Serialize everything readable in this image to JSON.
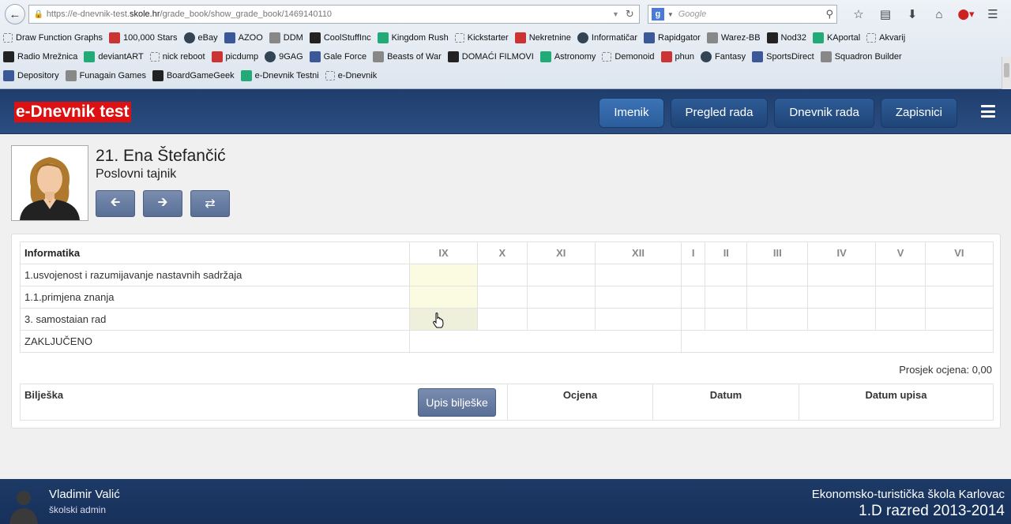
{
  "browser": {
    "url_prefix": "https://e-dnevnik-test.",
    "url_domain": "skole.hr",
    "url_path": "/grade_book/show_grade_book/1469140110",
    "search_placeholder": "Google",
    "bookmarks_row1": [
      "Draw Function Graphs",
      "100,000 Stars",
      "eBay",
      "AZOO",
      "DDM",
      "CoolStuffInc",
      "Kingdom Rush",
      "Kickstarter",
      "Nekretnine",
      "Informatičar",
      "Rapidgator",
      "Warez-BB",
      "Nod32",
      "KAportal",
      "Akvarij"
    ],
    "bookmarks_row2": [
      "Radio Mrežnica",
      "deviantART",
      "nick reboot",
      "picdump",
      "9GAG",
      "Gale Force",
      "Beasts of War",
      "DOMAĆI FILMOVI",
      "Astronomy",
      "Demonoid",
      "phun",
      "Fantasy",
      "SportsDirect",
      "Squadron Builder"
    ],
    "bookmarks_row3": [
      "Depository",
      "Funagain Games",
      "BoardGameGeek",
      "e-Dnevnik Testni",
      "e-Dnevnik"
    ]
  },
  "header": {
    "title": "e-Dnevnik test",
    "tabs": [
      {
        "label": "Imenik",
        "active": true
      },
      {
        "label": "Pregled rada",
        "active": false
      },
      {
        "label": "Dnevnik rada",
        "active": false
      },
      {
        "label": "Zapisnici",
        "active": false
      }
    ]
  },
  "student": {
    "name": "21. Ena Štefančić",
    "program": "Poslovni tajnik"
  },
  "grades": {
    "subject": "Informatika",
    "months": [
      "IX",
      "X",
      "XI",
      "XII",
      "I",
      "II",
      "III",
      "IV",
      "V",
      "VI"
    ],
    "rows": [
      "1.usvojenost i razumijavanje nastavnih sadržaja",
      "1.1.primjena znanja",
      "3. samostaian rad"
    ],
    "final_label": "ZAKLJUČENO",
    "average": "Prosjek ocjena: 0,00"
  },
  "notes": {
    "label": "Bilješka",
    "button": "Upis bilješke",
    "col_grade": "Ocjena",
    "col_date": "Datum",
    "col_entry_date": "Datum upisa"
  },
  "footer": {
    "user_name": "Vladimir Valić",
    "user_role": "školski admin",
    "school": "Ekonomsko-turistička škola Karlovac",
    "class": "1.D razred 2013-2014"
  }
}
